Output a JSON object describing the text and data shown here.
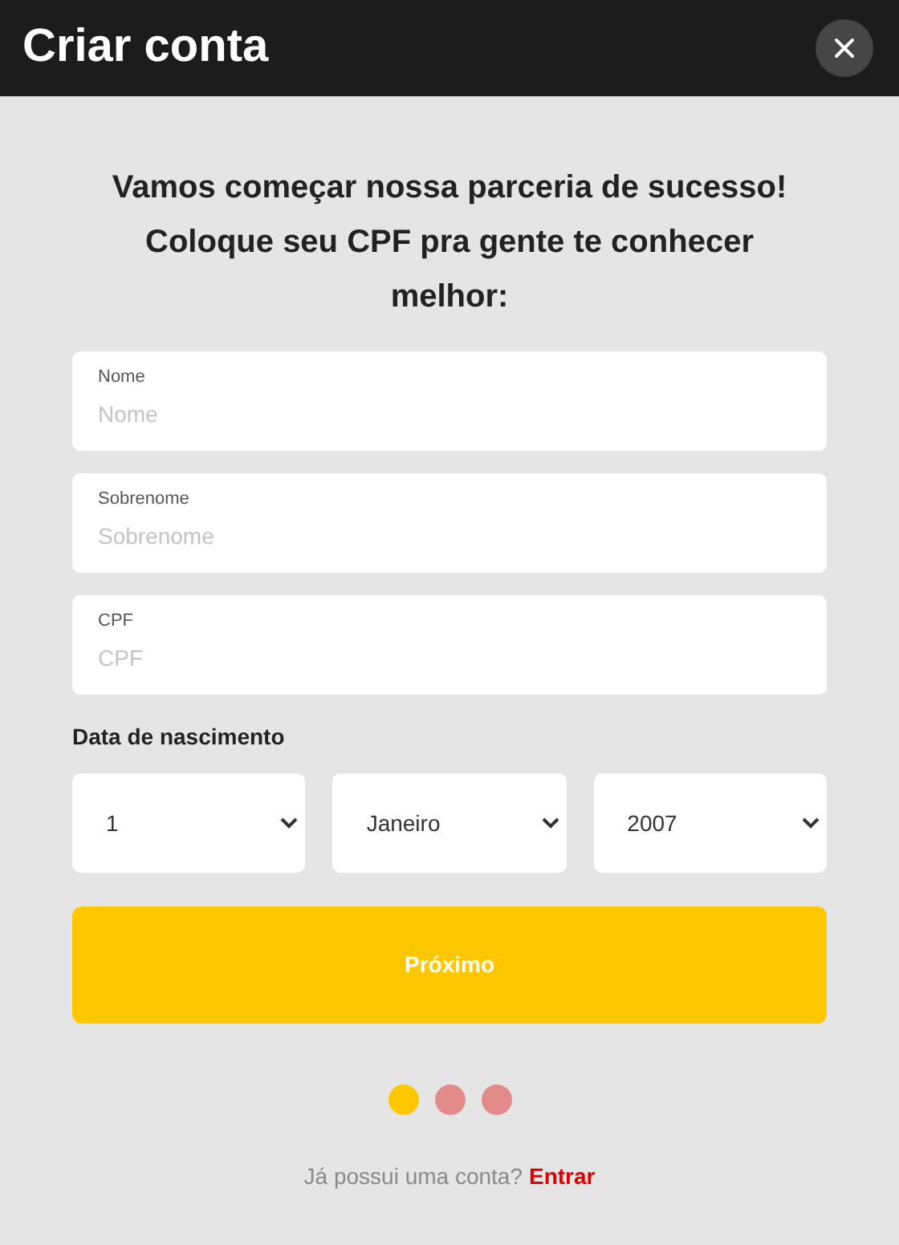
{
  "window": {
    "title": "Criar conta"
  },
  "intro": "Vamos começar nossa parceria de sucesso! Coloque seu CPF pra gente te conhecer melhor:",
  "fields": [
    {
      "label": "Nome",
      "placeholder": "Nome"
    },
    {
      "label": "Sobrenome",
      "placeholder": "Sobrenome"
    },
    {
      "label": "CPF",
      "placeholder": "CPF"
    }
  ],
  "birth_date": {
    "label": "Data de nascimento",
    "selects": [
      {
        "value": "1"
      },
      {
        "value": "Janeiro"
      },
      {
        "value": "2007"
      }
    ]
  },
  "next_button": "Próximo",
  "steps": [
    {
      "selected": true
    },
    {
      "selected": false
    },
    {
      "selected": false
    }
  ],
  "footer": {
    "text": "Já possui uma conta?",
    "link": "Entrar"
  }
}
